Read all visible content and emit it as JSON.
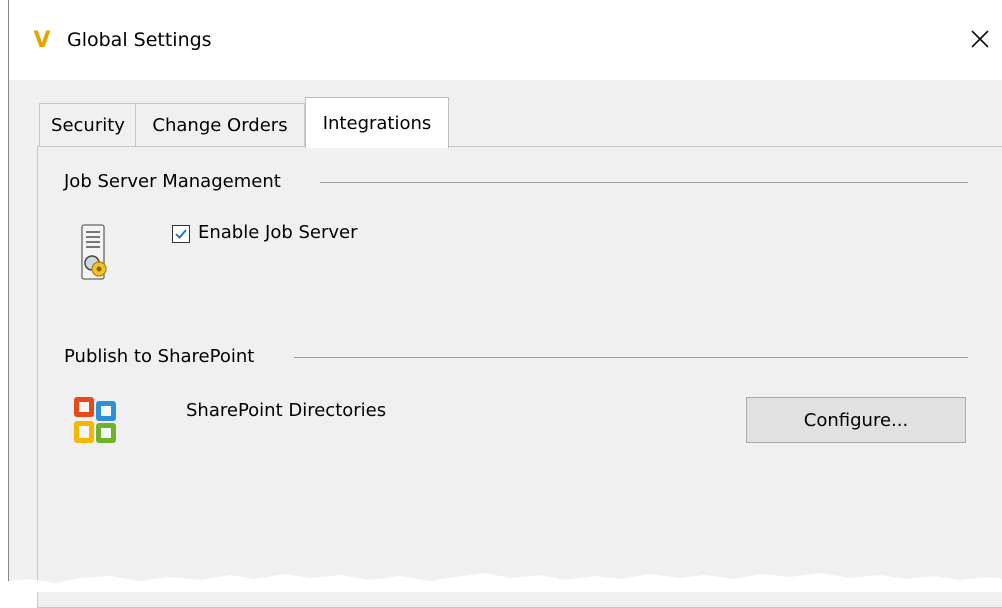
{
  "window": {
    "title": "Global Settings",
    "app_icon": "V",
    "close_icon": "close-icon"
  },
  "tabs": [
    {
      "label": "Security",
      "active": false
    },
    {
      "label": "Change Orders",
      "active": false
    },
    {
      "label": "Integrations",
      "active": true
    }
  ],
  "job_server": {
    "group_label": "Job Server Management",
    "checkbox_label": "Enable Job Server",
    "checked": true,
    "icon": "job-server-icon"
  },
  "sharepoint": {
    "group_label": "Publish to SharePoint",
    "label": "SharePoint Directories",
    "button_label": "Configure...",
    "icon": "office-icon"
  },
  "colors": {
    "app_icon": "#e8a200",
    "checkbox_check": "#1b6ec2",
    "panel_bg": "#f0f0f0",
    "button_bg": "#e1e1e1"
  }
}
